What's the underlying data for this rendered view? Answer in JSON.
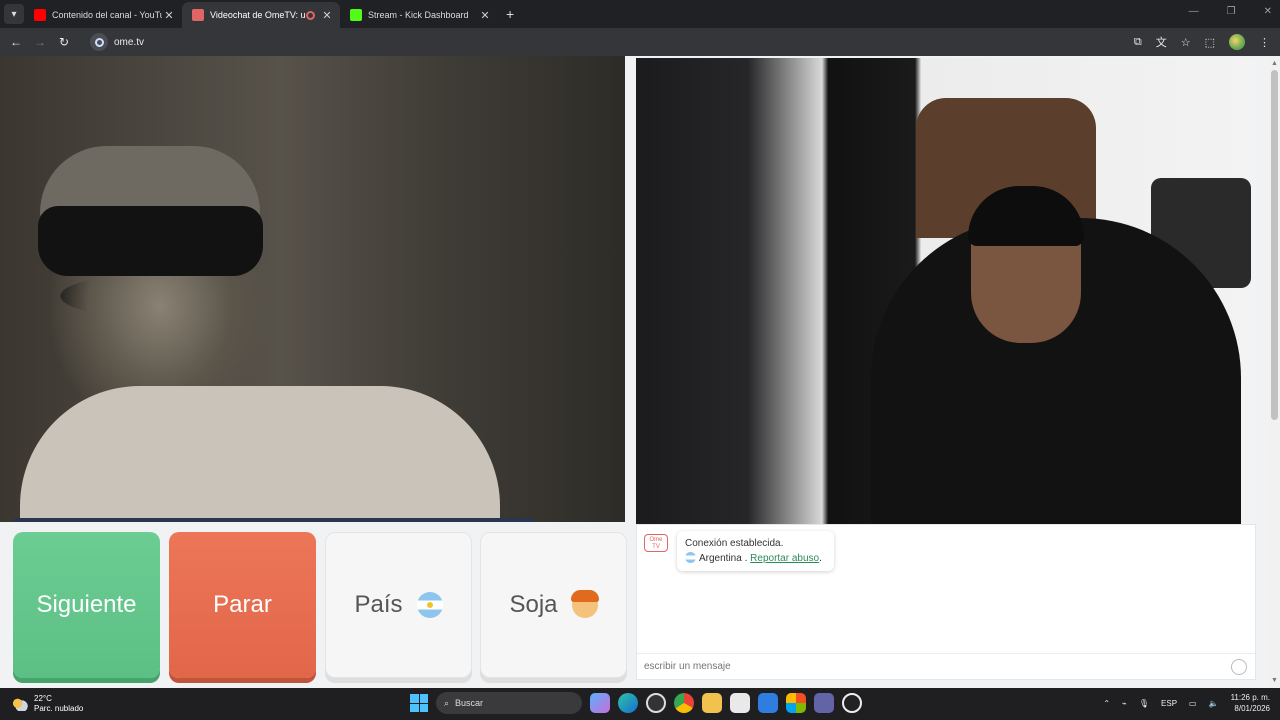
{
  "browser": {
    "tabs": [
      {
        "title": "Contenido del canal - YouTube",
        "favicon_color": "#ff0000",
        "active": false
      },
      {
        "title": "Videochat de OmeTV: una a",
        "favicon_color": "#e06666",
        "active": true
      },
      {
        "title": "Stream - Kick Dashboard",
        "favicon_color": "#53fc18",
        "active": false
      }
    ],
    "new_tab_label": "+",
    "url": "ome.tv"
  },
  "ometv": {
    "buttons": {
      "next": "Siguiente",
      "stop": "Parar",
      "country": "País",
      "gender": "Soja"
    },
    "chat": {
      "logo_text": "Ome TV",
      "connection_message": "Conexión establecida.",
      "country": "Argentina",
      "country_separator": " .",
      "report_link": "Reportar abuso",
      "report_suffix": ".",
      "input_placeholder": "escribir un mensaje"
    }
  },
  "taskbar": {
    "weather_temp": "22°C",
    "weather_desc": "Parc. nublado",
    "search_placeholder": "Buscar",
    "language": "ESP",
    "time": "11:26 p. m.",
    "date": "8/01/2026"
  },
  "colors": {
    "next_green": "#6ccd93",
    "stop_red": "#e2664a",
    "link_green": "#2e8b57",
    "chrome_dark": "#202124"
  }
}
